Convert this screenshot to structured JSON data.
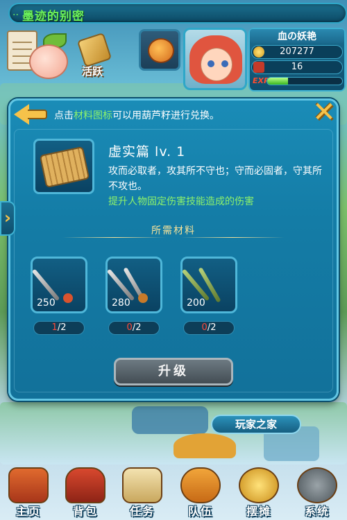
{
  "top_bar": {
    "title": "墨迹的别密"
  },
  "header": {
    "activity_label": "活跃",
    "player": {
      "name": "血の妖艳",
      "gold": "207277",
      "gift": "16",
      "exp_label": "EXP",
      "exp_fraction": 0.28
    }
  },
  "panel": {
    "hint_prefix": "点击",
    "hint_highlight": "材料图标",
    "hint_suffix": "可以用葫芦籽进行兑换。",
    "close_symbol": "✕",
    "skill": {
      "name": "虚实篇 lv. 1",
      "description": "攻而必取者，攻其所不守也；守而必固者，守其所不攻也。",
      "effect": "提升人物固定伤害技能造成的伤害"
    },
    "required_title": "所需材料",
    "materials": [
      {
        "count": "250",
        "have": "1",
        "need": "/2"
      },
      {
        "count": "280",
        "have": "0",
        "need": "/2"
      },
      {
        "count": "200",
        "have": "0",
        "need": "/2"
      }
    ],
    "upgrade_label": "升级"
  },
  "side_tab_symbol": "›",
  "home_label": "玩家之家",
  "nav": {
    "items": [
      {
        "label": "主页",
        "icon": "palace-icon"
      },
      {
        "label": "背包",
        "icon": "chest-icon"
      },
      {
        "label": "任务",
        "icon": "scroll-icon"
      },
      {
        "label": "队伍",
        "icon": "team-icon"
      },
      {
        "label": "摆摊",
        "icon": "coin-icon"
      },
      {
        "label": "系统",
        "icon": "gear-icon"
      }
    ]
  },
  "colors": {
    "accent_green": "#8df26b",
    "title_green": "#6cf25d",
    "panel_blue": "#1a8cb7",
    "gold": "#f6c24a",
    "red": "#ff4a3a"
  }
}
